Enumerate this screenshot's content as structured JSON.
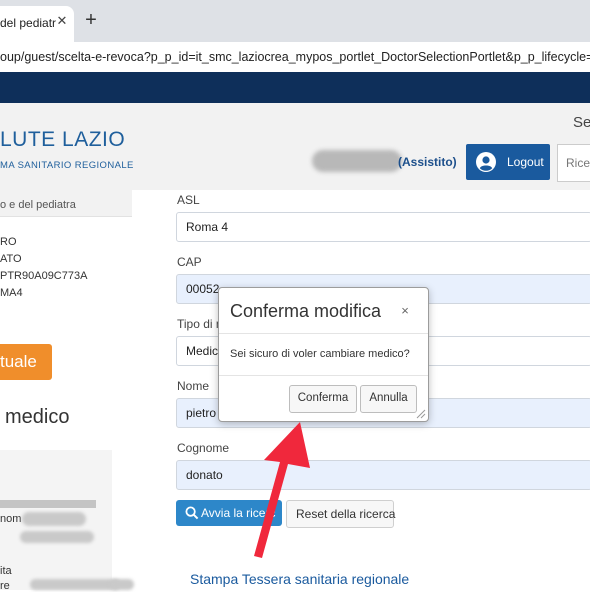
{
  "browser": {
    "tab_title": "del pediatr",
    "tab_close_icon": "close-icon",
    "new_tab_glyph": "+",
    "url": "oup/guest/scelta-e-revoca?p_p_id=it_smc_laziocrea_mypos_portlet_DoctorSelectionPortlet&p_p_lifecycle=0"
  },
  "header": {
    "brand_title": "LUTE LAZIO",
    "brand_subtitle": "MA SANITARIO REGIONALE",
    "right_text": "Se",
    "user_role": "(Assistito)",
    "logout_label": "Logout",
    "search_placeholder": "Ricer"
  },
  "left": {
    "panel_label": "o e del pediatra",
    "info_lines": [
      "RO",
      "ATO",
      "PTR90A09C773A",
      "MA4"
    ],
    "orange_button_label": "tuale",
    "heading": "medico",
    "box_lines": [
      "nom",
      "ita",
      "re"
    ]
  },
  "form": {
    "asl_label": "ASL",
    "asl_value": "Roma 4",
    "cap_label": "CAP",
    "cap_value": "00052",
    "tipo_label": "Tipo di m",
    "tipo_value": "Medic",
    "nome_label": "Nome",
    "nome_value": "pietro",
    "cognome_label": "Cognome",
    "cognome_value": "donato",
    "search_button_label": "Avvia la ricerc",
    "reset_button_label": "Reset della ricerca",
    "footer_link": "Stampa Tessera sanitaria regionale"
  },
  "modal": {
    "title": "Conferma modifica",
    "close_glyph": "×",
    "body": "Sei sicuro di voler cambiare medico?",
    "confirm_label": "Conferma",
    "cancel_label": "Annulla"
  },
  "colors": {
    "nav_band": "#0e2f5a",
    "brand_blue": "#1f5f9c",
    "logout_blue": "#1a5a9e",
    "search_blue": "#2d87c9",
    "orange": "#f08e2b",
    "annotation_arrow": "#f0283c"
  }
}
